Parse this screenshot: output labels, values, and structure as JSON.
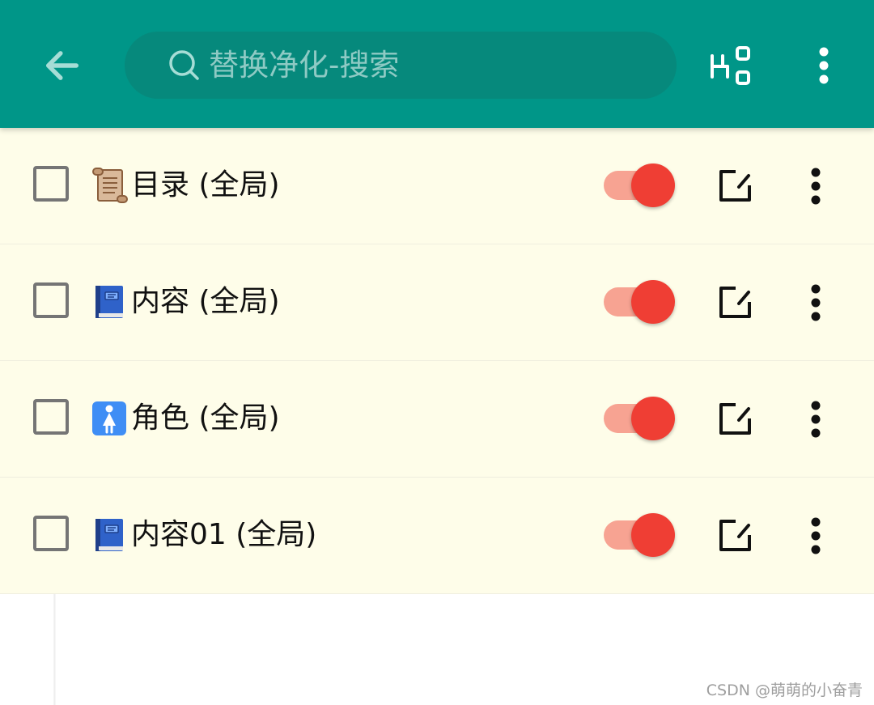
{
  "colors": {
    "appbar": "#009688",
    "search_box": "#06897c",
    "list_background": "#fefde9",
    "switch_thumb_on": "#ef3e34",
    "switch_track_on": "#f7a392"
  },
  "search": {
    "placeholder": "替换净化-搜索",
    "value": ""
  },
  "toolbar": {
    "back_icon": "arrow-left-icon",
    "group_icon": "group-by-icon",
    "more_icon": "more-vertical-icon"
  },
  "rules": [
    {
      "icon": "scroll-emoji",
      "label": "目录 (全局)",
      "checked": false,
      "enabled": true
    },
    {
      "icon": "blue-book-emoji",
      "label": "内容 (全局)",
      "checked": false,
      "enabled": true
    },
    {
      "icon": "womens-room-emoji",
      "label": "角色 (全局)",
      "checked": false,
      "enabled": true
    },
    {
      "icon": "blue-book-emoji",
      "label": "内容01 (全局)",
      "checked": false,
      "enabled": true
    }
  ],
  "watermark": "CSDN @萌萌的小奋青"
}
